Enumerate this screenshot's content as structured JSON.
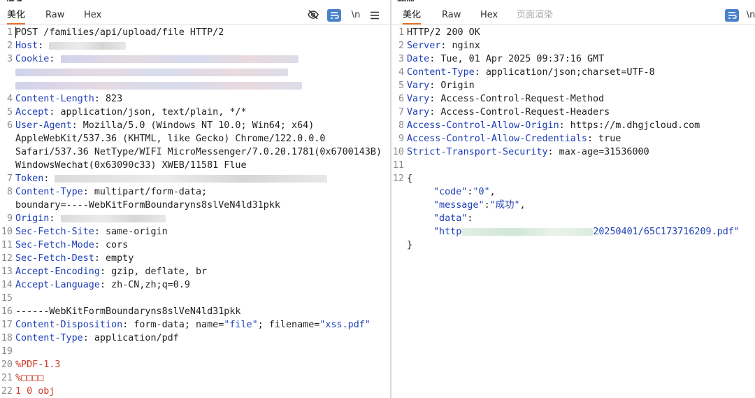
{
  "left_pane": {
    "title": "请求",
    "tabs": [
      {
        "label": "美化",
        "active": true
      },
      {
        "label": "Raw",
        "active": false
      },
      {
        "label": "Hex",
        "active": false
      }
    ],
    "toolbar": {
      "newline_label": "\\n",
      "menu_icon": "hamburger-icon",
      "hide_icon": "eye-off-icon",
      "wrap_icon": "word-wrap-icon"
    },
    "lines": {
      "l1": {
        "num": "1",
        "text": "POST /families/api/upload/file HTTP/2"
      },
      "l2": {
        "num": "2",
        "key": "Host",
        "sep": ": "
      },
      "l3": {
        "num": "3",
        "key": "Cookie",
        "sep": ": "
      },
      "l4": {
        "num": "4",
        "key": "Content-Length",
        "sep": ": ",
        "val": "823"
      },
      "l5": {
        "num": "5",
        "key": "Accept",
        "sep": ": ",
        "val": "application/json, text/plain, */*"
      },
      "l6": {
        "num": "6",
        "key": "User-Agent",
        "sep": ": ",
        "val": "Mozilla/5.0 (Windows NT 10.0; Win64; x64)"
      },
      "l6b": {
        "text": "AppleWebKit/537.36 (KHTML, like Gecko) Chrome/122.0.0.0"
      },
      "l6c": {
        "text": "Safari/537.36 NetType/WIFI MicroMessenger/7.0.20.1781(0x6700143B)"
      },
      "l6d": {
        "text": "WindowsWechat(0x63090c33) XWEB/11581 Flue"
      },
      "l7": {
        "num": "7",
        "key": "Token",
        "sep": ": "
      },
      "l8": {
        "num": "8",
        "key": "Content-Type",
        "sep": ": ",
        "val": "multipart/form-data;"
      },
      "l8b": {
        "text": "boundary=----WebKitFormBoundaryns8slVeN4ld31pkk"
      },
      "l9": {
        "num": "9",
        "key": "Origin",
        "sep": ": "
      },
      "l10": {
        "num": "10",
        "key": "Sec-Fetch-Site",
        "sep": ": ",
        "val": "same-origin"
      },
      "l11": {
        "num": "11",
        "key": "Sec-Fetch-Mode",
        "sep": ": ",
        "val": "cors"
      },
      "l12": {
        "num": "12",
        "key": "Sec-Fetch-Dest",
        "sep": ": ",
        "val": "empty"
      },
      "l13": {
        "num": "13",
        "key": "Accept-Encoding",
        "sep": ": ",
        "val": "gzip, deflate, br"
      },
      "l14": {
        "num": "14",
        "key": "Accept-Language",
        "sep": ": ",
        "val": "zh-CN,zh;q=0.9"
      },
      "l15": {
        "num": "15"
      },
      "l16": {
        "num": "16",
        "text": "------WebKitFormBoundaryns8slVeN4ld31pkk"
      },
      "l17": {
        "num": "17",
        "key": "Content-Disposition",
        "sep": ": ",
        "val1": "form-data; name=",
        "str1": "\"file\"",
        "val2": "; filename=",
        "str2": "\"xss.pdf\""
      },
      "l18": {
        "num": "18",
        "key": "Content-Type",
        "sep": ": ",
        "val": "application/pdf"
      },
      "l19": {
        "num": "19"
      },
      "l20": {
        "num": "20",
        "text": "%PDF-1.3"
      },
      "l21": {
        "num": "21",
        "text": "%□□□□"
      },
      "l22": {
        "num": "22",
        "text": "1 0 obj"
      },
      "l23": {
        "num": "23",
        "text": "<<"
      }
    }
  },
  "right_pane": {
    "title": "响应",
    "tabs": [
      {
        "label": "美化",
        "active": true
      },
      {
        "label": "Raw",
        "active": false
      },
      {
        "label": "Hex",
        "active": false
      },
      {
        "label": "页面渲染",
        "active": false
      }
    ],
    "toolbar": {
      "newline_label": "\\n",
      "wrap_icon": "word-wrap-icon"
    },
    "lines": {
      "r1": {
        "num": "1",
        "text": "HTTP/2 200 OK"
      },
      "r2": {
        "num": "2",
        "key": "Server",
        "sep": ": ",
        "val": "nginx"
      },
      "r3": {
        "num": "3",
        "key": "Date",
        "sep": ": ",
        "val": "Tue, 01 Apr 2025 09:37:16 GMT"
      },
      "r4": {
        "num": "4",
        "key": "Content-Type",
        "sep": ": ",
        "val": "application/json;charset=UTF-8"
      },
      "r5": {
        "num": "5",
        "key": "Vary",
        "sep": ": ",
        "val": "Origin"
      },
      "r6": {
        "num": "6",
        "key": "Vary",
        "sep": ": ",
        "val": "Access-Control-Request-Method"
      },
      "r7": {
        "num": "7",
        "key": "Vary",
        "sep": ": ",
        "val": "Access-Control-Request-Headers"
      },
      "r8": {
        "num": "8",
        "key": "Access-Control-Allow-Origin",
        "sep": ": ",
        "val": "https://m.dhgjcloud.com"
      },
      "r9": {
        "num": "9",
        "key": "Access-Control-Allow-Credentials",
        "sep": ": ",
        "val": "true"
      },
      "r10": {
        "num": "10",
        "key": "Strict-Transport-Security",
        "sep": ": ",
        "val": "max-age=31536000"
      },
      "r11": {
        "num": "11"
      },
      "r12": {
        "num": "12",
        "text": "{"
      },
      "r13": {
        "key": "\"code\"",
        "sep": ":",
        "str": "\"0\"",
        "end": ","
      },
      "r14": {
        "key": "\"message\"",
        "sep": ":",
        "str": "\"成功\"",
        "end": ","
      },
      "r15": {
        "key": "\"data\"",
        "sep": ":"
      },
      "r16": {
        "prefix": "\"http",
        "suffix": "20250401/65C173716209.pdf\""
      },
      "r17": {
        "text": "}"
      }
    }
  },
  "colors": {
    "key_blue": "#1f3fb6",
    "pdf_red": "#d23a2a",
    "tab_underline": "#e8722a",
    "wrap_button": "#4a82c9"
  }
}
